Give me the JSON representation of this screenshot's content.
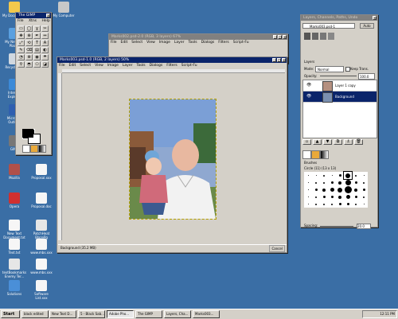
{
  "desktop_icons": [
    {
      "label": "My Documents",
      "color": "#f2c94c"
    },
    {
      "label": "My Network Places",
      "color": "#5aa0e0"
    },
    {
      "label": "Recycle Bin",
      "color": "#d0d8e0"
    },
    {
      "label": "Internet Explorer",
      "color": "#3c8ad8"
    },
    {
      "label": "Microsoft Outlook",
      "color": "#2f5fb0"
    },
    {
      "label": "GIMP",
      "color": "#777777"
    },
    {
      "label": "Mozilla",
      "color": "#b0504a"
    },
    {
      "label": "Opera",
      "color": "#d03030"
    },
    {
      "label": "New Text Document.txt",
      "color": "#f6f6f6"
    },
    {
      "label": "Text.txt",
      "color": "#f6f6f6"
    },
    {
      "label": "textBookmarks Enemy Ter...",
      "color": "#e6e6e6"
    },
    {
      "label": "Solutions",
      "color": "#4a8fd8"
    },
    {
      "label": "My Computer",
      "color": "#c8c8c8"
    },
    {
      "label": "Proposal.xxx",
      "color": "#f6f6f6"
    },
    {
      "label": "Proposal.doc",
      "color": "#f6f6f6"
    },
    {
      "label": "PatchHeat BlazePg",
      "color": "#e6e6e6"
    },
    {
      "label": "www.mbs.xxx",
      "color": "#f6f6f6"
    },
    {
      "label": "www.mbs.xxx",
      "color": "#f6f6f6"
    },
    {
      "label": "Software List.xxx",
      "color": "#f6f6f6"
    }
  ],
  "toolbox": {
    "title": "The GIMP",
    "menu": [
      "File",
      "Xtns",
      "Help"
    ],
    "tools": [
      "▭",
      "◯",
      "ɣ",
      "✂",
      "✥",
      "⊕",
      "✒",
      "↔",
      "⤢",
      "⟲",
      "T",
      "A",
      "✎",
      "⌫",
      "▤",
      "◐",
      "◔",
      "⊗",
      "◉",
      "☂",
      "⚲",
      "◓",
      "⎔",
      "◪"
    ]
  },
  "back_window": {
    "title": "Marks002.psd-2.0 (RGB, 3 layers) 67%",
    "menu": [
      "File",
      "Edit",
      "Select",
      "View",
      "Image",
      "Layer",
      "Tools",
      "Dialogs",
      "Filters",
      "Script-Fu"
    ]
  },
  "image_window": {
    "title": "Marks003.psd-1.0 (RGB, 2 layers) 50%",
    "menu": [
      "File",
      "Edit",
      "Select",
      "View",
      "Image",
      "Layer",
      "Tools",
      "Dialogs",
      "Filters",
      "Script-Fu"
    ],
    "status": "Background (35.2 MB)",
    "cancel": "Cancel"
  },
  "layers_dialog": {
    "title": "Layers, Channels, Paths, Undo",
    "image_select": "Marks003.psd-1",
    "auto_label": "Auto",
    "section_title": "Layers",
    "mode_label": "Mode:",
    "mode_value": "Normal",
    "keep_trans": "Keep Trans.",
    "opacity_label": "Opacity:",
    "opacity_value": "100.0",
    "layers": [
      {
        "name": "Layer 1 copy",
        "selected": false
      },
      {
        "name": "Background",
        "selected": true
      }
    ],
    "brushes_title": "Brushes",
    "brush_name": "Circle (11) (13 x 13)",
    "spacing_label": "Spacing:",
    "spacing_value": "20.0"
  },
  "taskbar": {
    "start": "Start",
    "tasks": [
      {
        "label": "black edited",
        "active": false
      },
      {
        "label": "New Text D...",
        "active": false
      },
      {
        "label": "5 - Black Sab...",
        "active": false
      },
      {
        "label": "Adobe Pho...",
        "active": true
      },
      {
        "label": "The GIMP",
        "active": false
      },
      {
        "label": "Layers, Cha...",
        "active": false
      },
      {
        "label": "Marks003...",
        "active": false
      }
    ],
    "clock": "12:11 PM"
  },
  "colors": {
    "desktop": "#3a6ea5",
    "titlebar_active": "#0a246a",
    "face": "#d4d0c8"
  }
}
